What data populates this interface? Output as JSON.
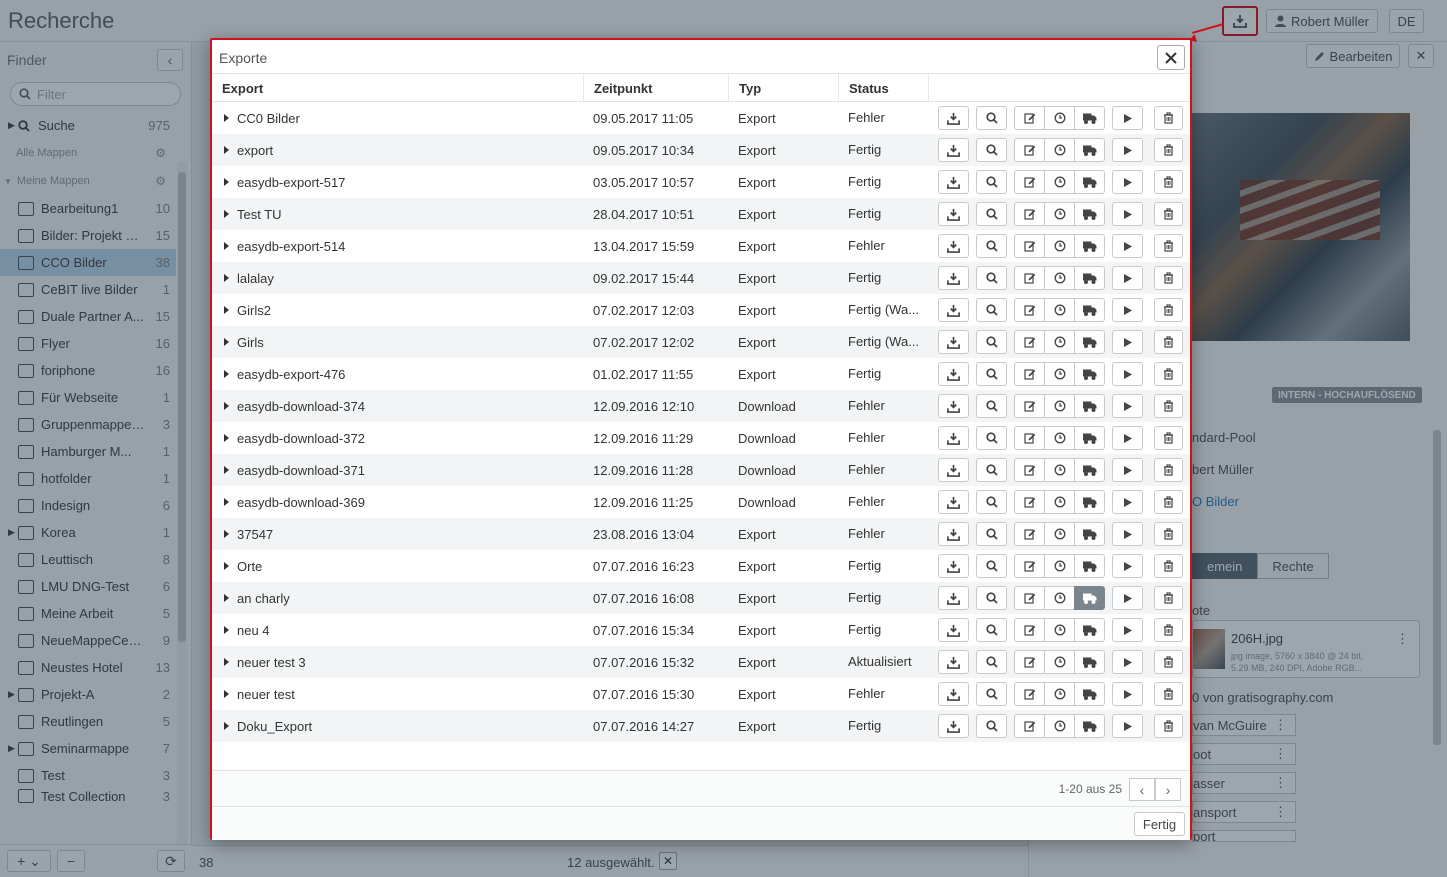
{
  "app": {
    "title": "Recherche",
    "user_name": "Robert Müller",
    "language": "DE"
  },
  "sidebar": {
    "title": "Finder",
    "filter_placeholder": "Filter",
    "search_label": "Suche",
    "search_count": "975",
    "all_folders_label": "Alle Mappen",
    "my_folders_label": "Meine Mappen",
    "items": [
      {
        "label": "Bearbeitung1",
        "count": "10"
      },
      {
        "label": "Bilder: Projekt M...",
        "count": "15"
      },
      {
        "label": "CCO Bilder",
        "count": "38"
      },
      {
        "label": "CeBIT live Bilder",
        "count": "1"
      },
      {
        "label": "Duale Partner A...",
        "count": "15"
      },
      {
        "label": "Flyer",
        "count": "16"
      },
      {
        "label": "foriphone",
        "count": "16"
      },
      {
        "label": "Für Webseite",
        "count": "1"
      },
      {
        "label": "Gruppenmappe -...",
        "count": "3"
      },
      {
        "label": "Hamburger M...",
        "count": "1"
      },
      {
        "label": "hotfolder",
        "count": "1"
      },
      {
        "label": "Indesign",
        "count": "6"
      },
      {
        "label": "Korea",
        "count": "1"
      },
      {
        "label": "Leuttisch",
        "count": "8"
      },
      {
        "label": "LMU DNG-Test",
        "count": "6"
      },
      {
        "label": "Meine Arbeit",
        "count": "5"
      },
      {
        "label": "NeueMappeCeBIT",
        "count": "9"
      },
      {
        "label": "Neustes Hotel",
        "count": "13"
      },
      {
        "label": "Projekt-A",
        "count": "2"
      },
      {
        "label": "Reutlingen",
        "count": "5"
      },
      {
        "label": "Seminarmappe",
        "count": "7"
      },
      {
        "label": "Test",
        "count": "3"
      },
      {
        "label": "Test Collection",
        "count": "3"
      }
    ]
  },
  "center": {
    "result_count": "38",
    "selected_text": "12 ausgewählt."
  },
  "right_panel": {
    "edit_label": "Bearbeiten",
    "badge": "INTERN - HOCHAUFLÖSEND",
    "pool": "ndard-Pool",
    "owner": "bert Müller",
    "folder_link": "O Bilder",
    "tab_general": "emein",
    "tab_rights": "Rechte",
    "section_label": "ote",
    "file_name": "206H.jpg",
    "file_meta_1": "jpg image,  5760 x 3840 @ 24 bit,",
    "file_meta_2": "5.29 MB,  240 DPI,  Adobe RGB...",
    "source": "0 von gratisography.com",
    "keywords": [
      "van McGuire",
      "oot",
      "asser",
      "ansport",
      "port"
    ]
  },
  "modal": {
    "title": "Exporte",
    "columns": {
      "export": "Export",
      "time": "Zeitpunkt",
      "type": "Typ",
      "status": "Status"
    },
    "rows": [
      {
        "name": "CC0 Bilder",
        "time": "09.05.2017 11:05",
        "type": "Export",
        "status": "Fehler"
      },
      {
        "name": "export",
        "time": "09.05.2017 10:34",
        "type": "Export",
        "status": "Fertig"
      },
      {
        "name": "easydb-export-517",
        "time": "03.05.2017 10:57",
        "type": "Export",
        "status": "Fertig"
      },
      {
        "name": "Test TU",
        "time": "28.04.2017 10:51",
        "type": "Export",
        "status": "Fertig"
      },
      {
        "name": "easydb-export-514",
        "time": "13.04.2017 15:59",
        "type": "Export",
        "status": "Fehler"
      },
      {
        "name": "lalalay",
        "time": "09.02.2017 15:44",
        "type": "Export",
        "status": "Fertig"
      },
      {
        "name": "Girls2",
        "time": "07.02.2017 12:03",
        "type": "Export",
        "status": "Fertig (Wa..."
      },
      {
        "name": "Girls",
        "time": "07.02.2017 12:02",
        "type": "Export",
        "status": "Fertig (Wa..."
      },
      {
        "name": "easydb-export-476",
        "time": "01.02.2017 11:55",
        "type": "Export",
        "status": "Fertig"
      },
      {
        "name": "easydb-download-374",
        "time": "12.09.2016 12:10",
        "type": "Download",
        "status": "Fehler"
      },
      {
        "name": "easydb-download-372",
        "time": "12.09.2016 11:29",
        "type": "Download",
        "status": "Fehler"
      },
      {
        "name": "easydb-download-371",
        "time": "12.09.2016 11:28",
        "type": "Download",
        "status": "Fehler"
      },
      {
        "name": "easydb-download-369",
        "time": "12.09.2016 11:25",
        "type": "Download",
        "status": "Fehler"
      },
      {
        "name": "37547",
        "time": "23.08.2016 13:04",
        "type": "Export",
        "status": "Fehler"
      },
      {
        "name": "Orte",
        "time": "07.07.2016 16:23",
        "type": "Export",
        "status": "Fertig"
      },
      {
        "name": "an charly",
        "time": "07.07.2016 16:08",
        "type": "Export",
        "status": "Fertig",
        "transport_active": true
      },
      {
        "name": "neu 4",
        "time": "07.07.2016 15:34",
        "type": "Export",
        "status": "Fertig"
      },
      {
        "name": "neuer test 3",
        "time": "07.07.2016 15:32",
        "type": "Export",
        "status": "Aktualisiert"
      },
      {
        "name": "neuer test",
        "time": "07.07.2016 15:30",
        "type": "Export",
        "status": "Fehler"
      },
      {
        "name": "Doku_Export",
        "time": "07.07.2016 14:27",
        "type": "Export",
        "status": "Fertig"
      }
    ],
    "pager_text": "1-20 aus 25",
    "done_label": "Fertig"
  },
  "colors": {
    "highlight_border": "#d0121b",
    "selected_row": "#bcd7ee",
    "active_button": "#7a858d"
  }
}
